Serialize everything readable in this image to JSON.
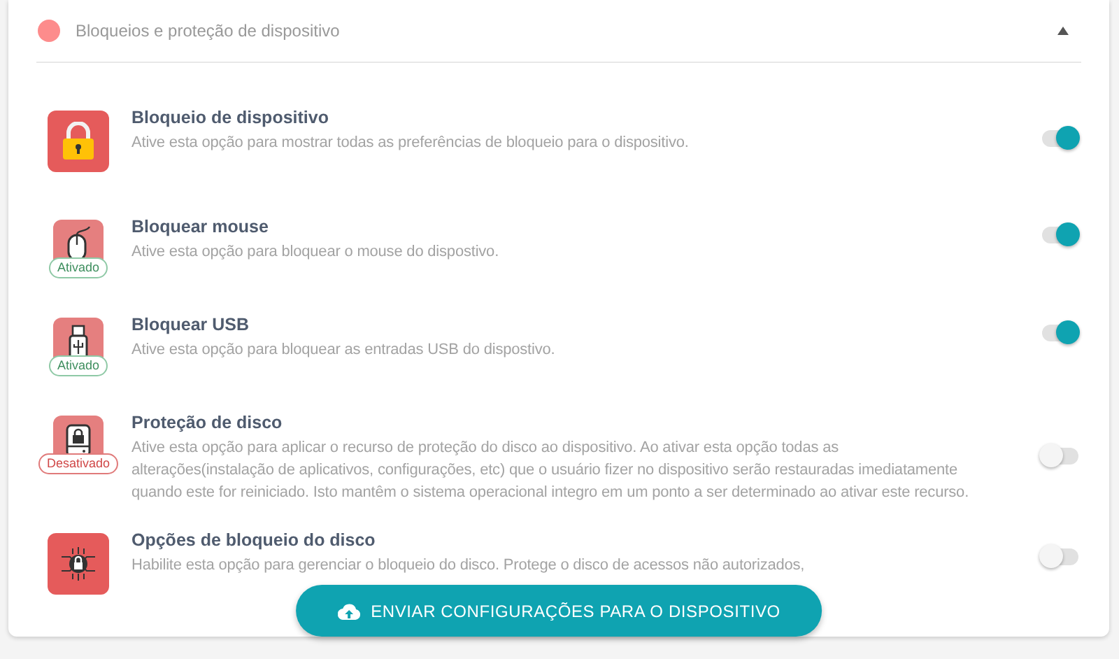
{
  "panel": {
    "title": "Bloqueios e proteção de dispositivo",
    "expanded": true
  },
  "options": [
    {
      "title": "Bloqueio de dispositivo",
      "description": "Ative esta opção para mostrar todas as preferências de bloqueio para o dispositivo.",
      "on": true
    },
    {
      "title": "Bloquear mouse",
      "description": "Ative esta opção para bloquear o mouse do dispostivo.",
      "on": true,
      "status": {
        "label": "Ativado",
        "enabled": true
      }
    },
    {
      "title": "Bloquear USB",
      "description": "Ative esta opção para bloquear as entradas USB do dispostivo.",
      "on": true,
      "status": {
        "label": "Ativado",
        "enabled": true
      }
    },
    {
      "title": "Proteção de disco",
      "description": "Ative esta opção para aplicar o recurso de proteção do disco ao dispositivo. Ao ativar esta opção todas as alterações(instalação de aplicativos, configurações, etc) que o usuário fizer no dispositivo serão restauradas imediatamente quando este for reiniciado. Isto mantêm o sistema operacional integro em um ponto a ser determinado ao ativar este recurso.",
      "on": false,
      "status": {
        "label": "Desativado",
        "enabled": false
      }
    },
    {
      "title": "Opções de bloqueio do disco",
      "description": "Habilite esta opção para gerenciar o bloqueio do disco. Protege o disco de acessos não autorizados,",
      "on": false
    }
  ],
  "send_button": {
    "label": "ENVIAR CONFIGURAÇÕES PARA O DISPOSITIVO"
  }
}
